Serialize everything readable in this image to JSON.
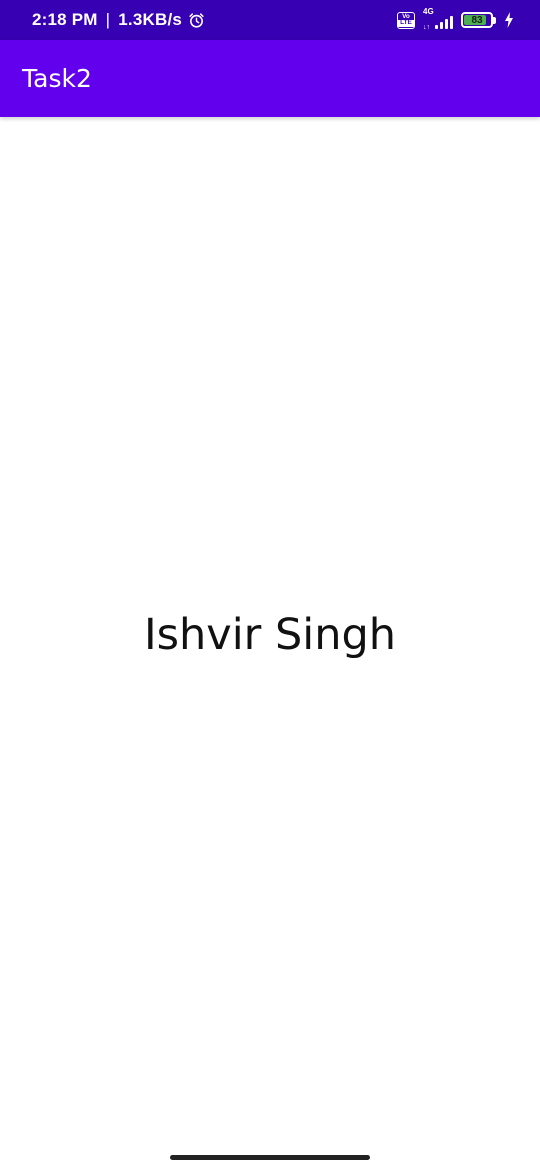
{
  "status_bar": {
    "time": "2:18 PM",
    "separator": "|",
    "net_speed": "1.3KB/s",
    "volte_top": "Vo",
    "volte_bottom": "LTE",
    "network_type": "4G",
    "data_arrows": "↓↑",
    "battery_level": "83",
    "battery_fraction": 0.83,
    "battery_color": "#4CAF50",
    "icons": [
      "alarm-icon",
      "volte-icon",
      "signal-icon",
      "battery-icon",
      "charging-icon"
    ]
  },
  "app_bar": {
    "title": "Task2",
    "color": "#6200EE"
  },
  "content": {
    "text": "Ishvir Singh"
  },
  "colors": {
    "status_bar": "#3700B3",
    "app_bar": "#6200EE",
    "background": "#FFFFFF"
  }
}
